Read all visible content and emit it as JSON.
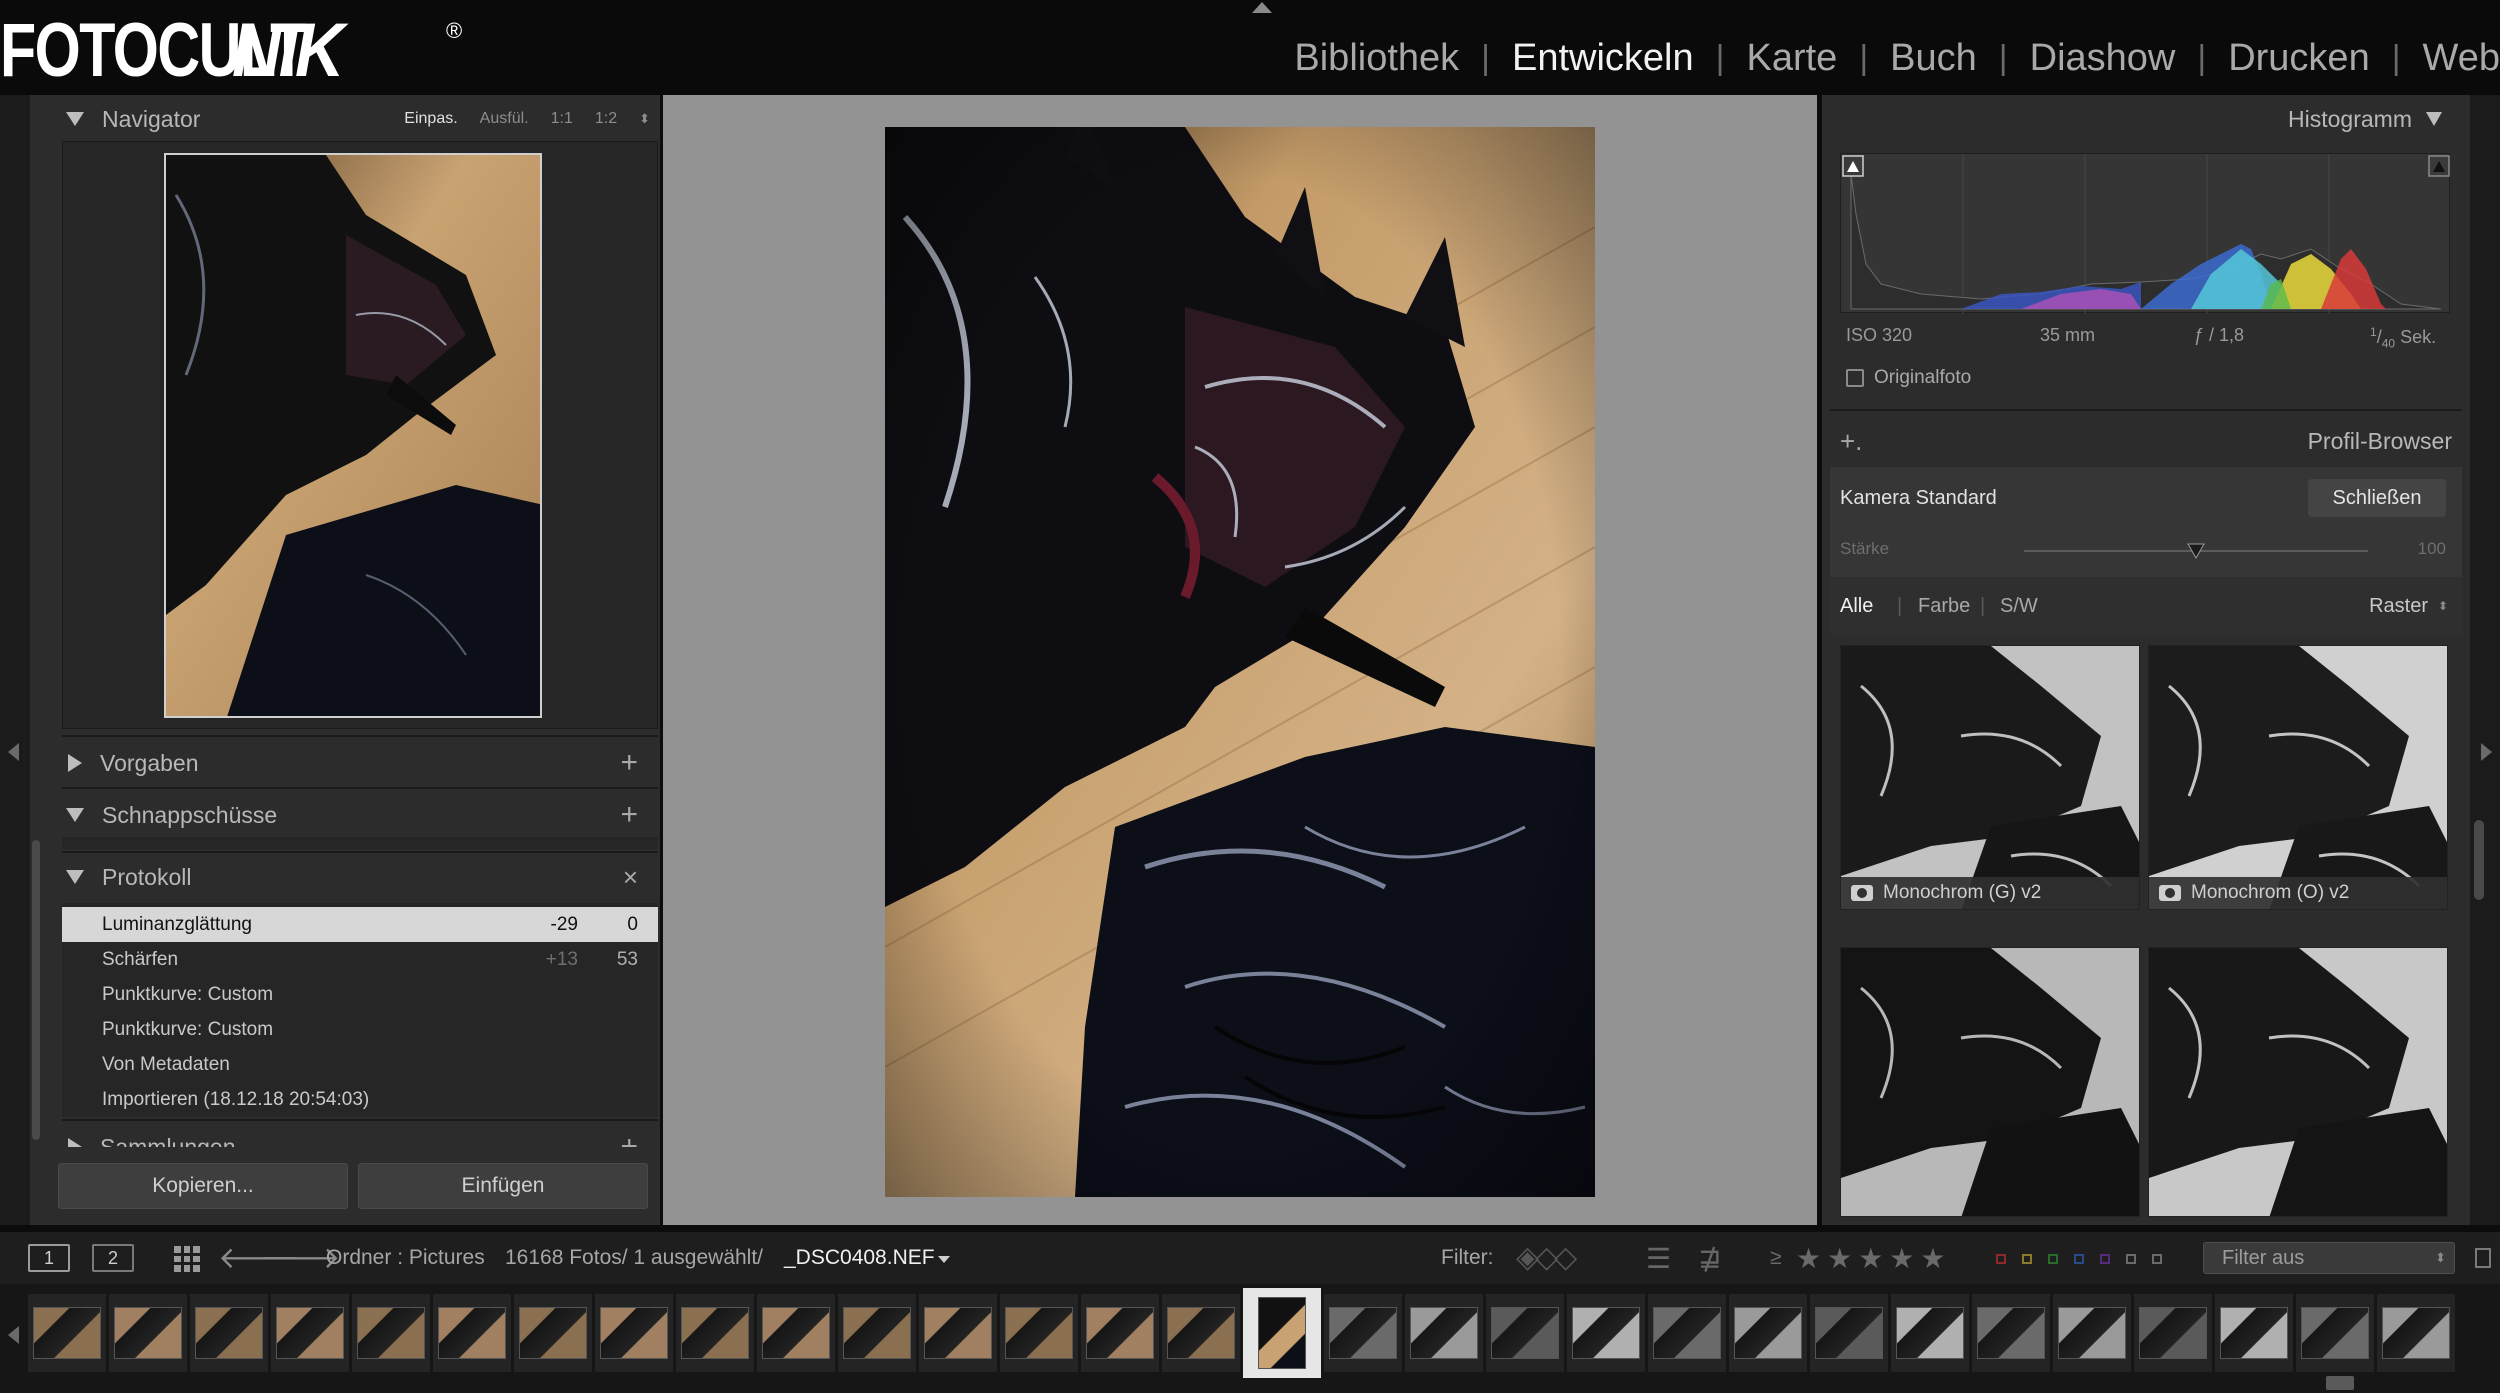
{
  "app": {
    "logo_text": "FOTOCULT",
    "logo_text_2": "NIK",
    "logo_reg": "®",
    "modules": [
      "Bibliothek",
      "Entwickeln",
      "Karte",
      "Buch",
      "Diashow",
      "Drucken",
      "Web"
    ],
    "active_module": "Entwickeln",
    "module_separator": "|"
  },
  "left_panel": {
    "navigator": {
      "title": "Navigator",
      "zoom_options": [
        "Einpas.",
        "Ausfül.",
        "1:1",
        "1:2"
      ],
      "zoom_active": "Einpas."
    },
    "presets": {
      "title": "Vorgaben",
      "action": "+"
    },
    "snapshots": {
      "title": "Schnappschüsse",
      "action": "+"
    },
    "history": {
      "title": "Protokoll",
      "action": "×",
      "items": [
        {
          "label": "Luminanzglättung",
          "v1": "-29",
          "v2": "0",
          "selected": true
        },
        {
          "label": "Schärfen",
          "v1": "+13",
          "v2": "53",
          "selected": false
        },
        {
          "label": "Punktkurve: Custom",
          "v1": "",
          "v2": "",
          "selected": false
        },
        {
          "label": "Punktkurve: Custom",
          "v1": "",
          "v2": "",
          "selected": false
        },
        {
          "label": "Von Metadaten",
          "v1": "",
          "v2": "",
          "selected": false
        },
        {
          "label": "Importieren (18.12.18 20:54:03)",
          "v1": "",
          "v2": "",
          "selected": false
        }
      ]
    },
    "collections": {
      "title": "Sammlungen",
      "action": "+"
    },
    "copy_button": "Kopieren...",
    "paste_button": "Einfügen"
  },
  "right_panel": {
    "histogram": {
      "title": "Histogramm",
      "iso": "ISO 320",
      "focal": "35 mm",
      "aperture": "ƒ / 1,8",
      "shutter_num": "1",
      "shutter_den": "40",
      "shutter_unit": "Sek.",
      "original_photo": "Originalfoto"
    },
    "profile_browser": {
      "title": "Profil-Browser",
      "add": "+.",
      "profile_name": "Kamera Standard",
      "close_button": "Schließen",
      "strength_label": "Stärke",
      "strength_value": "100",
      "strength_fraction": 0.5,
      "filters": [
        "Alle",
        "Farbe",
        "S/W"
      ],
      "filter_active": "Alle",
      "view_mode": "Raster",
      "tiles": [
        {
          "label": "Monochrom (G) v2"
        },
        {
          "label": "Monochrom (O) v2"
        },
        {
          "label": ""
        },
        {
          "label": ""
        }
      ]
    }
  },
  "filmstrip_toolbar": {
    "page1": "1",
    "page2": "2",
    "source": "Ordner : Pictures",
    "count": "16168 Fotos/ 1 ausgewählt/",
    "filename": "_DSC0408.NEF",
    "filter_label": "Filter:",
    "rating_op": "≥",
    "stars": "★★★★★",
    "filter_select": "Filter aus",
    "color_flags": [
      "#b03030",
      "#b0a030",
      "#3a8a3a",
      "#3a5ab0",
      "#7a3a9a",
      "#7a7a7a",
      "#7a7a7a"
    ]
  },
  "filmstrip": {
    "selected_index": 15,
    "thumb_count": 30
  }
}
